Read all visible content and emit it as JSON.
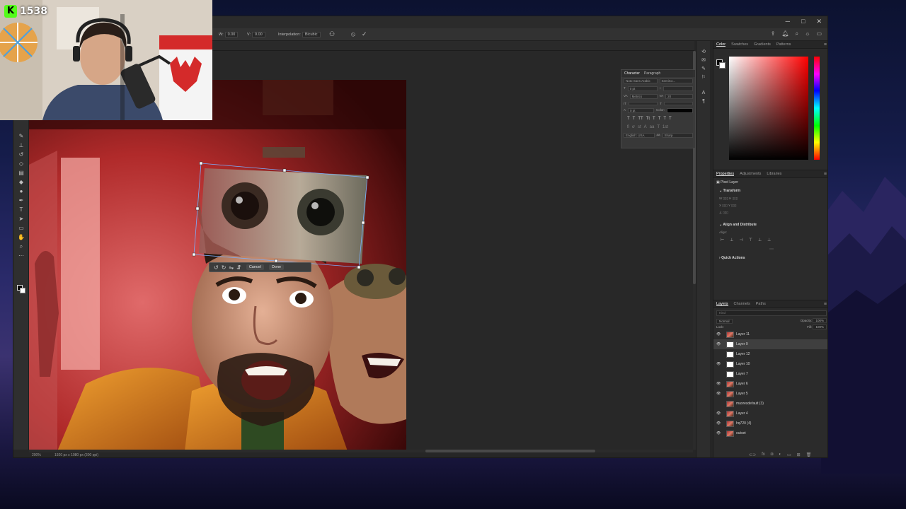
{
  "stream": {
    "viewer_count": "1538",
    "logo_letter": "K"
  },
  "options_bar": {
    "w_label": "W:",
    "w_value": "0.00",
    "h_label": "V:",
    "h_value": "0.00",
    "interpolation_label": "Interpolation:",
    "interpolation_value": "Bicubic"
  },
  "transform_bar": {
    "cancel": "Cancel",
    "done": "Done"
  },
  "character": {
    "tabs": [
      "Character",
      "Paragraph"
    ],
    "font": "Noto Sans Arabic",
    "style": "SemiCo...",
    "size": "0 pt",
    "kerning": "Metrics",
    "tracking": "20",
    "baseline": "0 pt",
    "color_label": "Color:",
    "language": "English: USA",
    "aa": "Sharp"
  },
  "color_panel": {
    "tabs": [
      "Color",
      "Swatches",
      "Gradients",
      "Patterns"
    ]
  },
  "properties": {
    "tabs": [
      "Properties",
      "Adjustments",
      "Libraries"
    ],
    "layer_type": "Pixel Layer",
    "transform": "Transform",
    "align": "Align and Distribute",
    "align_label": "Align:",
    "quick_actions": "Quick Actions"
  },
  "layers": {
    "tabs": [
      "Layers",
      "Channels",
      "Paths"
    ],
    "search_placeholder": "Kind",
    "blend_mode": "Normal",
    "opacity_label": "Opacity:",
    "opacity_value": "100%",
    "lock_label": "Lock:",
    "fill_label": "Fill:",
    "fill_value": "100%",
    "items": [
      {
        "name": "Layer 11",
        "visible": true,
        "selected": false
      },
      {
        "name": "Layer 9",
        "visible": true,
        "selected": true
      },
      {
        "name": "Layer 12",
        "visible": false,
        "selected": false
      },
      {
        "name": "Layer 10",
        "visible": true,
        "selected": false
      },
      {
        "name": "Layer 7",
        "visible": false,
        "selected": false
      },
      {
        "name": "Layer 6",
        "visible": true,
        "selected": false
      },
      {
        "name": "Layer 5",
        "visible": true,
        "selected": false
      },
      {
        "name": "maxresdefault (3)",
        "visible": false,
        "selected": false
      },
      {
        "name": "Layer 4",
        "visible": true,
        "selected": false
      },
      {
        "name": "hq720 (4)",
        "visible": true,
        "selected": false
      },
      {
        "name": "outset",
        "visible": true,
        "selected": false
      }
    ]
  },
  "status": {
    "zoom": "200%",
    "doc_info": "1920 px x 1080 px (300 ppi)"
  },
  "colors": {
    "accent": "#53fc18",
    "canvas_bg": "#282828",
    "panel_bg": "#2b2b2b"
  }
}
